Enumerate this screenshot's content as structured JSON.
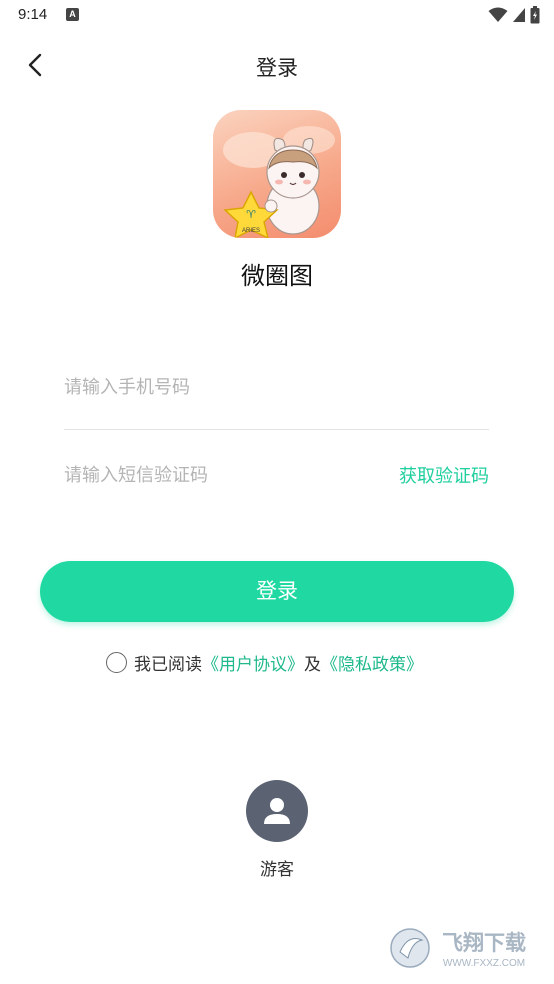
{
  "status_bar": {
    "time": "9:14",
    "notification_icon": "a-badge-icon",
    "icons": [
      "wifi-icon",
      "signal-icon",
      "battery-icon"
    ]
  },
  "nav": {
    "back_icon": "chevron-left-icon",
    "title": "登录"
  },
  "app": {
    "logo_icon": "app-logo-sheep-icon",
    "logo_star_text": "ARIES",
    "name": "微圈图"
  },
  "form": {
    "phone_placeholder": "请输入手机号码",
    "phone_value": "",
    "code_placeholder": "请输入短信验证码",
    "code_value": "",
    "get_code_label": "获取验证码",
    "login_label": "登录"
  },
  "agreement": {
    "checked": false,
    "prefix": "我已阅读",
    "user_agreement": "《用户协议》",
    "conjunction": "及",
    "privacy_policy": "《隐私政策》"
  },
  "guest": {
    "icon": "user-avatar-icon",
    "label": "游客"
  },
  "watermark": {
    "title": "飞翔下载",
    "url": "WWW.FXXZ.COM"
  },
  "colors": {
    "accent": "#20d9a2",
    "link": "#1fb98c",
    "guest_bg": "#5b6373"
  }
}
